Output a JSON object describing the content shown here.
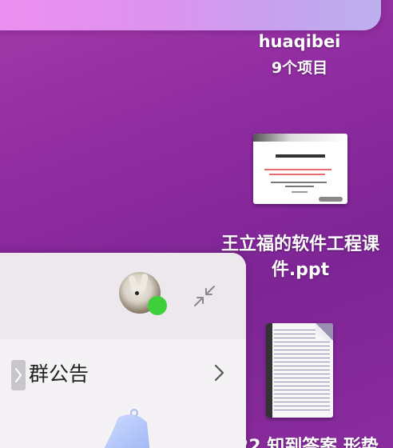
{
  "top_window": {
    "partial_glyph": "b"
  },
  "desktop": {
    "folder": {
      "name": "huaqibei",
      "item_count": "9个项目"
    },
    "ppt_file": {
      "name": "王立福的软件工程课件.ppt",
      "thumbnail": {
        "title": "软件工程基础"
      }
    },
    "doc_file": {
      "name": "22 知到答案 形势"
    }
  },
  "chat_panel": {
    "avatar": {
      "status": "online",
      "status_color": "#3ecf3a"
    },
    "shrink_icon": "shrink-arrows-icon",
    "announcement": {
      "label": "群公告"
    }
  }
}
